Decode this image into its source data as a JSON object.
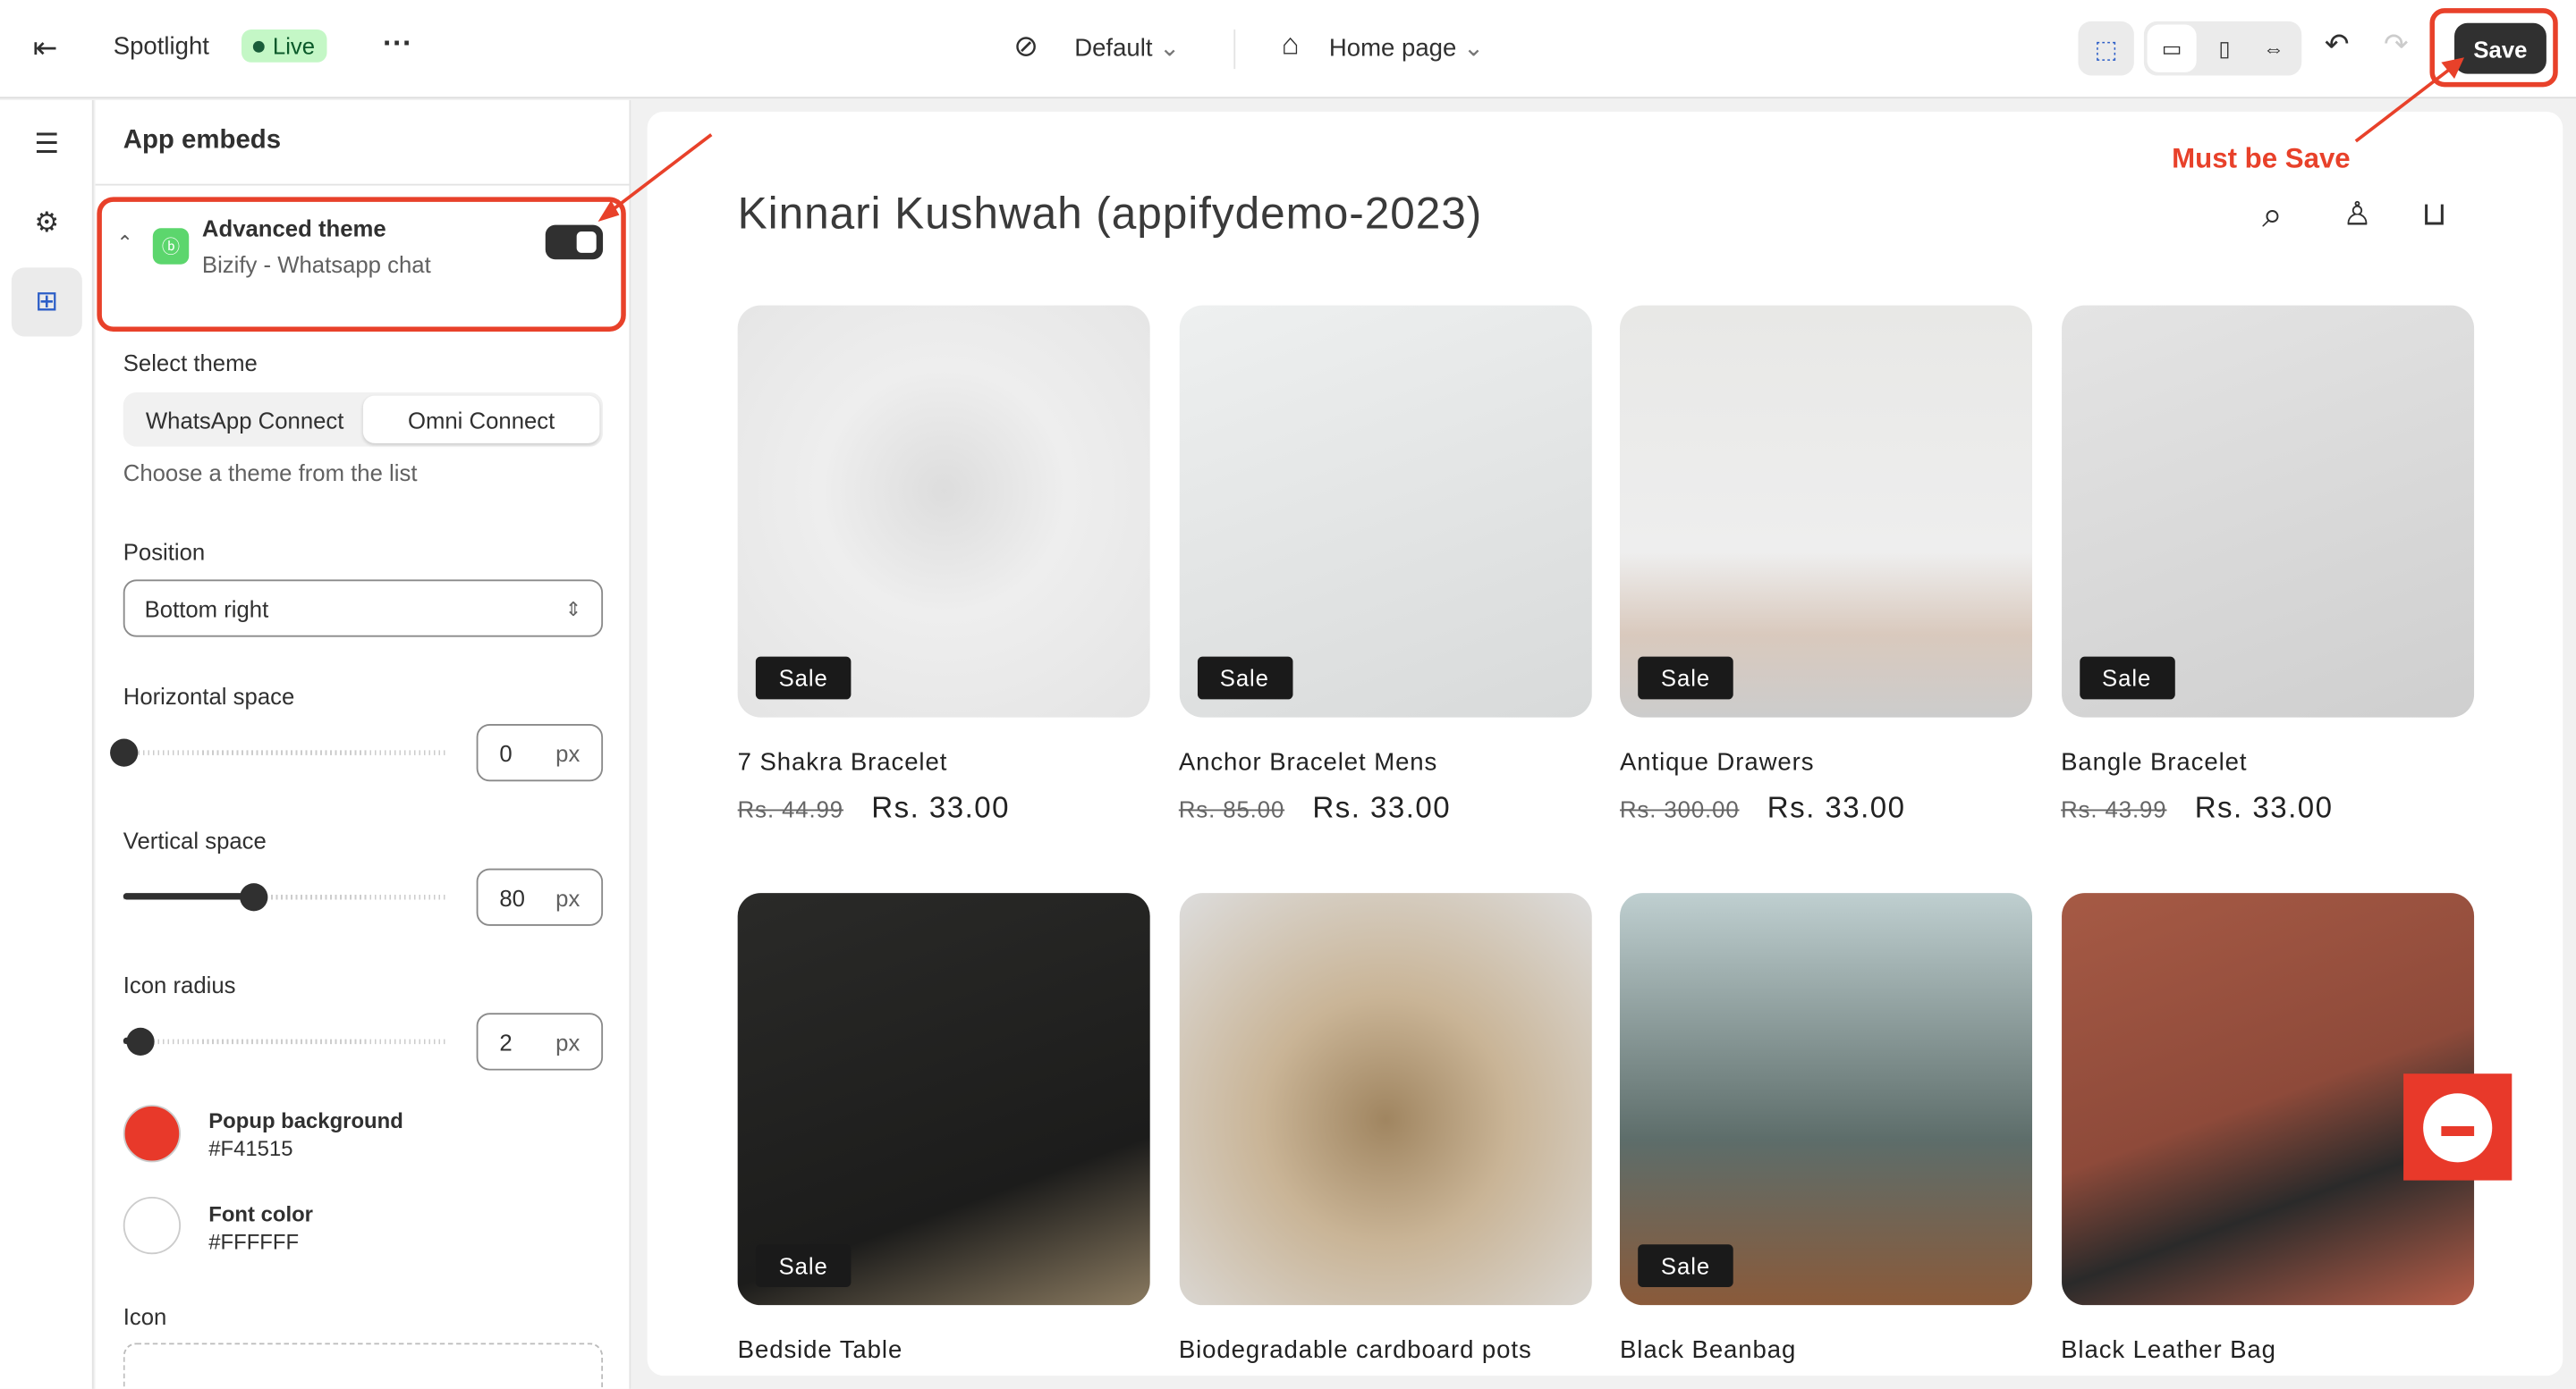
{
  "topbar": {
    "store_name": "Spotlight",
    "status": "Live",
    "theme": "Default",
    "page": "Home page",
    "save": "Save"
  },
  "panel": {
    "title": "App embeds",
    "embed": {
      "name": "Advanced theme",
      "app": "Bizify - Whatsapp chat",
      "enabled": true
    },
    "select_theme_label": "Select theme",
    "theme_options": [
      "WhatsApp Connect",
      "Omni Connect"
    ],
    "theme_selected": "Omni Connect",
    "theme_help": "Choose a theme from the list",
    "position_label": "Position",
    "position_value": "Bottom right",
    "horizontal": {
      "label": "Horizontal space",
      "value": "0",
      "unit": "px",
      "fraction": 0
    },
    "vertical": {
      "label": "Vertical space",
      "value": "80",
      "unit": "px",
      "fraction": 0.4
    },
    "radius": {
      "label": "Icon radius",
      "value": "2",
      "unit": "px",
      "fraction": 0.05
    },
    "popup_bg": {
      "label": "Popup background",
      "value": "#F41515",
      "color": "#e8392a"
    },
    "font_color": {
      "label": "Font color",
      "value": "#FFFFFF",
      "color": "#ffffff"
    },
    "icon_label": "Icon"
  },
  "annotation": {
    "text": "Must be Save",
    "color": "#e8412a"
  },
  "preview": {
    "store_title": "Kinnari Kushwah (appifydemo-2023)",
    "products": [
      {
        "name": "7 Shakra Bracelet",
        "old": "Rs. 44.99",
        "price": "Rs. 33.00",
        "badge": "Sale"
      },
      {
        "name": "Anchor Bracelet Mens",
        "old": "Rs. 85.00",
        "price": "Rs. 33.00",
        "badge": "Sale"
      },
      {
        "name": "Antique Drawers",
        "old": "Rs. 300.00",
        "price": "Rs. 33.00",
        "badge": "Sale"
      },
      {
        "name": "Bangle Bracelet",
        "old": "Rs. 43.99",
        "price": "Rs. 33.00",
        "badge": "Sale"
      },
      {
        "name": "Bedside Table",
        "badge": "Sale"
      },
      {
        "name": "Biodegradable cardboard pots"
      },
      {
        "name": "Black Beanbag",
        "badge": "Sale"
      },
      {
        "name": "Black Leather Bag"
      }
    ]
  }
}
